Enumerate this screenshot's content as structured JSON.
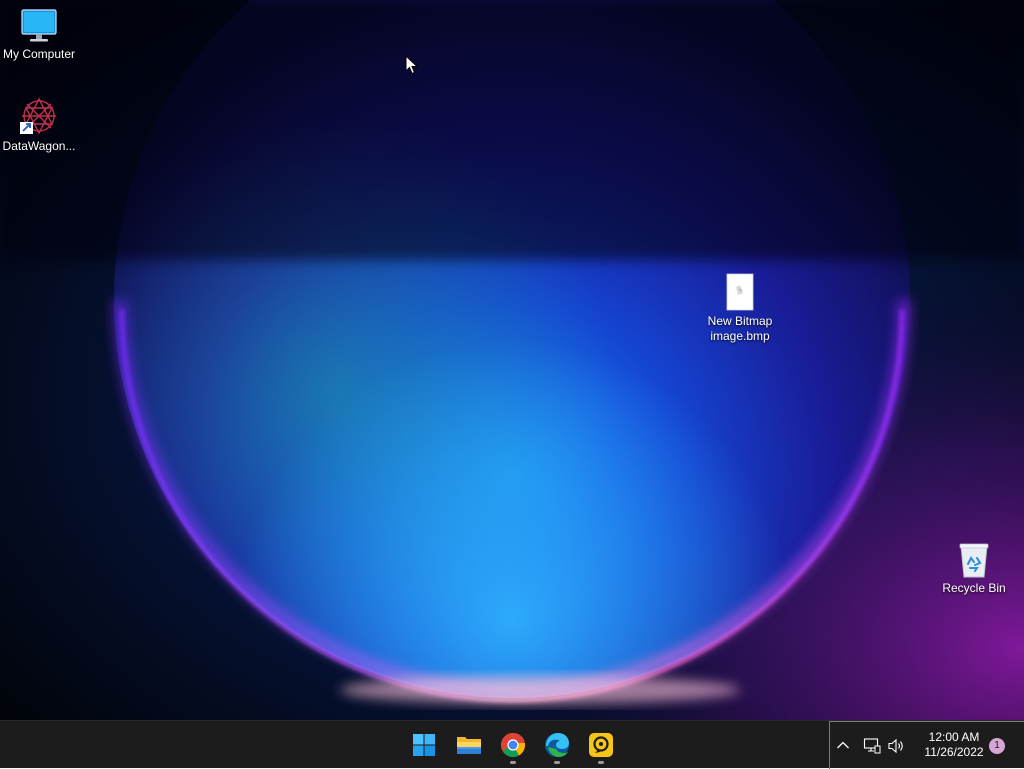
{
  "desktop": {
    "icons": [
      {
        "label": "My Computer",
        "icon": "monitor-icon"
      },
      {
        "label": "DataWagon...",
        "icon": "datawagon-icon"
      },
      {
        "label": "New Bitmap\nimage.bmp",
        "icon": "bitmap-file-icon"
      },
      {
        "label": "Recycle Bin",
        "icon": "recycle-bin-icon"
      }
    ]
  },
  "taskbar": {
    "apps": [
      {
        "name": "Start",
        "icon": "windows-start-icon"
      },
      {
        "name": "File Explorer",
        "icon": "folder-icon"
      },
      {
        "name": "Google Chrome",
        "icon": "chrome-icon"
      },
      {
        "name": "Microsoft Edge",
        "icon": "edge-icon"
      },
      {
        "name": "Remote app",
        "icon": "remote-app-icon"
      }
    ],
    "tray": {
      "time": "12:00 AM",
      "date": "11/26/2022",
      "notifications": "1"
    }
  },
  "colors": {
    "taskbar_bg": "#1c1c1c",
    "wallpaper_blue": "#1a3cff",
    "wallpaper_magenta": "#c21bd6"
  }
}
